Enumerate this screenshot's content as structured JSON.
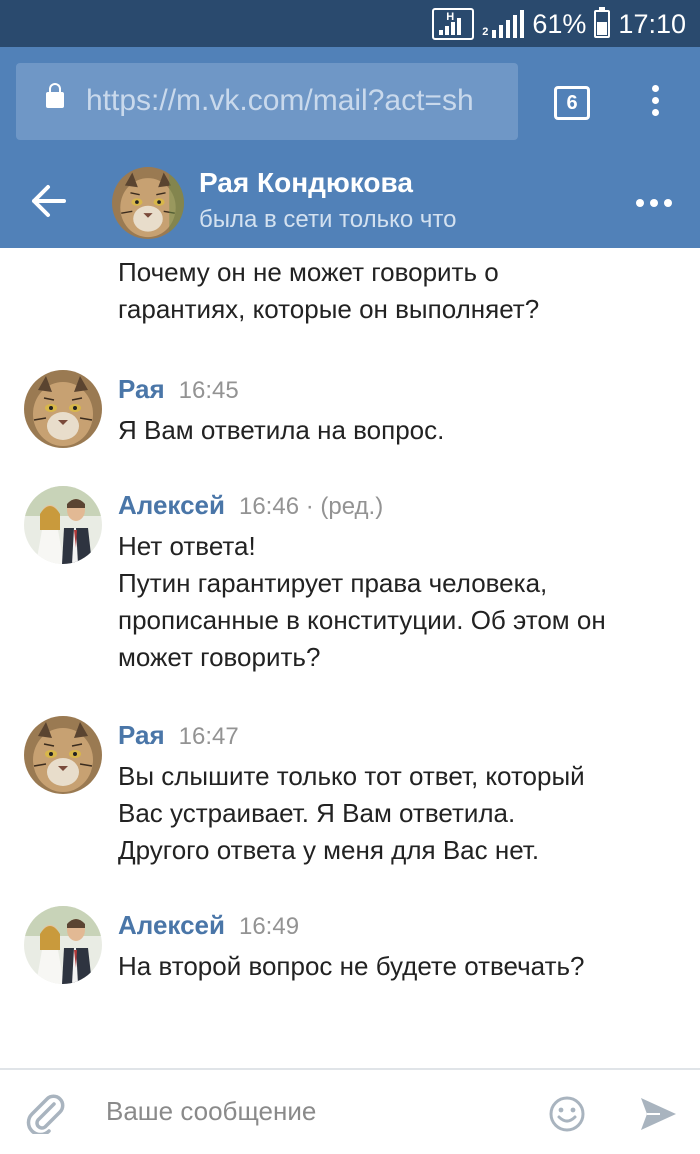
{
  "status_bar": {
    "network_letter": "H",
    "sim_label": "2",
    "battery_percent": "61%",
    "battery_level": 0.61,
    "time": "17:10"
  },
  "browser": {
    "url": "https://m.vk.com/mail?act=sh",
    "tab_count": "6",
    "accent": "#5181b8"
  },
  "chat_header": {
    "name": "Рая Кондюкова",
    "status": "была в сети только что"
  },
  "messages": {
    "partial_lines": [
      "Почему он не может говорить о",
      "гарантиях, которые он выполняет?"
    ],
    "list": [
      {
        "author": "Рая",
        "time": "16:45",
        "edited": "",
        "avatar": "lynx-avatar",
        "lines": [
          "Я Вам ответила на вопрос."
        ]
      },
      {
        "author": "Алексей",
        "time": "16:46",
        "edited": " · (ред.)",
        "avatar": "couple-photo-avatar",
        "lines": [
          "Нет ответа!",
          "Путин гарантирует права человека,",
          "прописанные в конституции. Об этом он",
          "может говорить?"
        ]
      },
      {
        "author": "Рая",
        "time": "16:47",
        "edited": "",
        "avatar": "lynx-avatar",
        "lines": [
          "Вы слышите только тот ответ, который",
          "Вас устраивает. Я Вам ответила.",
          "Другого ответа у меня для Вас нет."
        ]
      },
      {
        "author": "Алексей",
        "time": "16:49",
        "edited": "",
        "avatar": "couple-photo-avatar",
        "lines": [
          "На второй вопрос не будете отвечать?"
        ]
      }
    ]
  },
  "composer": {
    "placeholder": "Ваше сообщение"
  },
  "icons": {
    "back": "arrow-left-icon",
    "more": "more-dots-icon",
    "attach": "paperclip-icon",
    "emoji": "smiley-icon",
    "send": "send-icon",
    "lock": "lock-icon",
    "menu": "kebab-icon"
  }
}
